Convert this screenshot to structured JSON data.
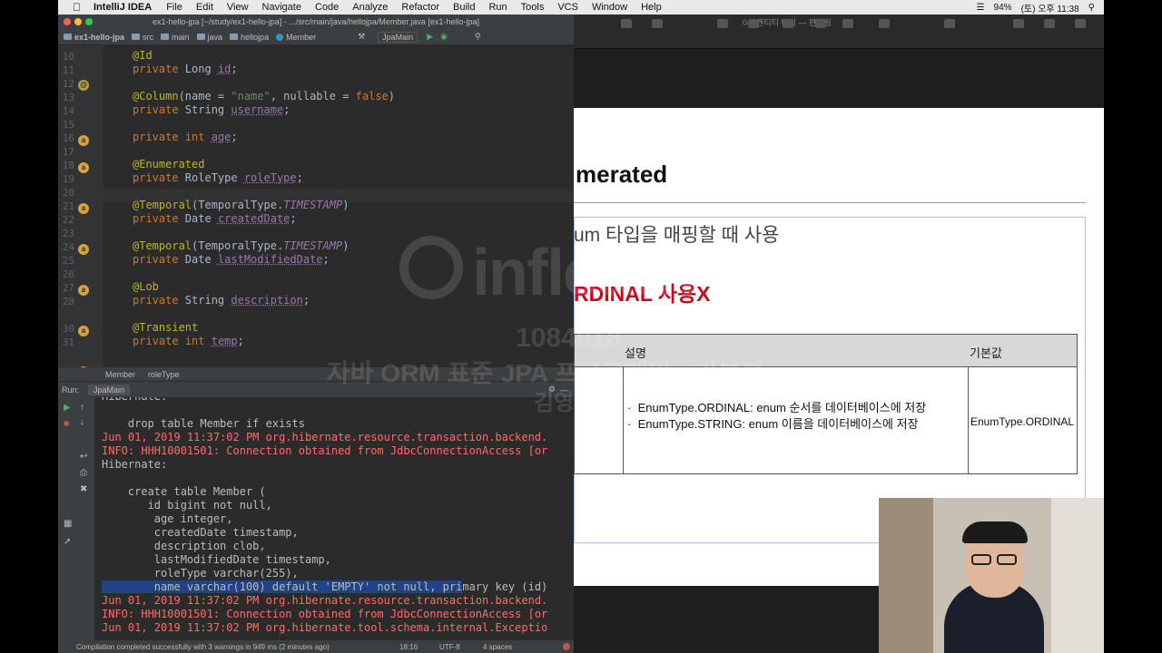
{
  "menubar": {
    "app": "IntelliJ IDEA",
    "items": [
      "File",
      "Edit",
      "View",
      "Navigate",
      "Code",
      "Analyze",
      "Refactor",
      "Build",
      "Run",
      "Tools",
      "VCS",
      "Window",
      "Help"
    ],
    "battery": "94%",
    "clock": "(토) 오후 11:38"
  },
  "ide": {
    "window_title": "ex1-hello-jpa [~/study/ex1-hello-jpa] - .../src/main/java/hellojpa/Member.java [ex1-hello-jpa]",
    "nav": [
      "ex1-hello-jpa",
      "src",
      "main",
      "java",
      "hellojpa",
      "Member"
    ],
    "run_config": "JpaMain",
    "code_lines": [
      {
        "n": "10",
        "text": "@Id"
      },
      {
        "n": "11",
        "text": "private Long id;"
      },
      {
        "n": "12",
        "text": ""
      },
      {
        "n": "13",
        "text": "@Column(name = \"name\", nullable = false)"
      },
      {
        "n": "14",
        "text": "private String username;"
      },
      {
        "n": "15",
        "text": ""
      },
      {
        "n": "16",
        "text": "private int age;"
      },
      {
        "n": "17",
        "text": ""
      },
      {
        "n": "18",
        "text": "@Enumerated"
      },
      {
        "n": "19",
        "text": "private RoleType roleType;"
      },
      {
        "n": "20",
        "text": ""
      },
      {
        "n": "21",
        "text": "@Temporal(TemporalType.TIMESTAMP)"
      },
      {
        "n": "22",
        "text": "private Date createdDate;"
      },
      {
        "n": "23",
        "text": ""
      },
      {
        "n": "24",
        "text": "@Temporal(TemporalType.TIMESTAMP)"
      },
      {
        "n": "25",
        "text": "private Date lastModifiedDate;"
      },
      {
        "n": "26",
        "text": ""
      },
      {
        "n": "27",
        "text": "@Lob"
      },
      {
        "n": "28",
        "text": "private String description;"
      },
      {
        "n": "30",
        "text": "@Transient"
      },
      {
        "n": "31",
        "text": "private int temp;"
      }
    ],
    "breadcrumb": [
      "Member",
      "roleType"
    ],
    "run_label": "Run:",
    "run_tab": "JpaMain",
    "console": [
      {
        "t": "Hibernate:",
        "c": "white"
      },
      {
        "t": "",
        "c": "white"
      },
      {
        "t": "    drop table Member if exists",
        "c": "white"
      },
      {
        "t": "Jun 01, 2019 11:37:02 PM org.hibernate.resource.transaction.backend.",
        "c": "red"
      },
      {
        "t": "INFO: HHH10001501: Connection obtained from JdbcConnectionAccess [or",
        "c": "red"
      },
      {
        "t": "Hibernate:",
        "c": "white"
      },
      {
        "t": "",
        "c": "white"
      },
      {
        "t": "    create table Member (",
        "c": "white"
      },
      {
        "t": "       id bigint not null,",
        "c": "white"
      },
      {
        "t": "        age integer,",
        "c": "white"
      },
      {
        "t": "        createdDate timestamp,",
        "c": "white"
      },
      {
        "t": "        description clob,",
        "c": "white"
      },
      {
        "t": "        lastModifiedDate timestamp,",
        "c": "white"
      },
      {
        "t": "        roleType varchar(255),",
        "c": "white"
      },
      {
        "t": "        name varchar(100) default 'EMPTY' not null, primary key (id)",
        "c": "white"
      },
      {
        "t": "Jun 01, 2019 11:37:02 PM org.hibernate.resource.transaction.backend.",
        "c": "red"
      },
      {
        "t": "INFO: HHH10001501: Connection obtained from JdbcConnectionAccess [or",
        "c": "red"
      },
      {
        "t": "Jun 01, 2019 11:37:02 PM org.hibernate.tool.schema.internal.Exceptio",
        "c": "red"
      }
    ],
    "status": "Compilation completed successfully with 3 warnings in 949 ms (2 minutes ago)",
    "status_pos": "18:16",
    "status_enc": "UTF-8",
    "status_indent": "4 spaces"
  },
  "keynote": {
    "title": "04. 엔티티 매핑 — 편집됨",
    "slide_heading": "merated",
    "slide_sub1": "um 타입을 매핑할 때 사용",
    "slide_warn": "RDINAL 사용X",
    "table_head": [
      "설명",
      "기본값"
    ],
    "table_bullets": [
      "EnumType.ORDINAL: enum 순서를 데이터베이스에 저장",
      "EnumType.STRING: enum 이름을 데이터베이스에 저장"
    ],
    "table_default": "EnumType.ORDINAL"
  },
  "watermark": {
    "brand": "inflearn",
    "id": "1084018",
    "course": "자바 ORM 표준 JPA 프로그래밍 - 기본편",
    "author": "김영한"
  }
}
